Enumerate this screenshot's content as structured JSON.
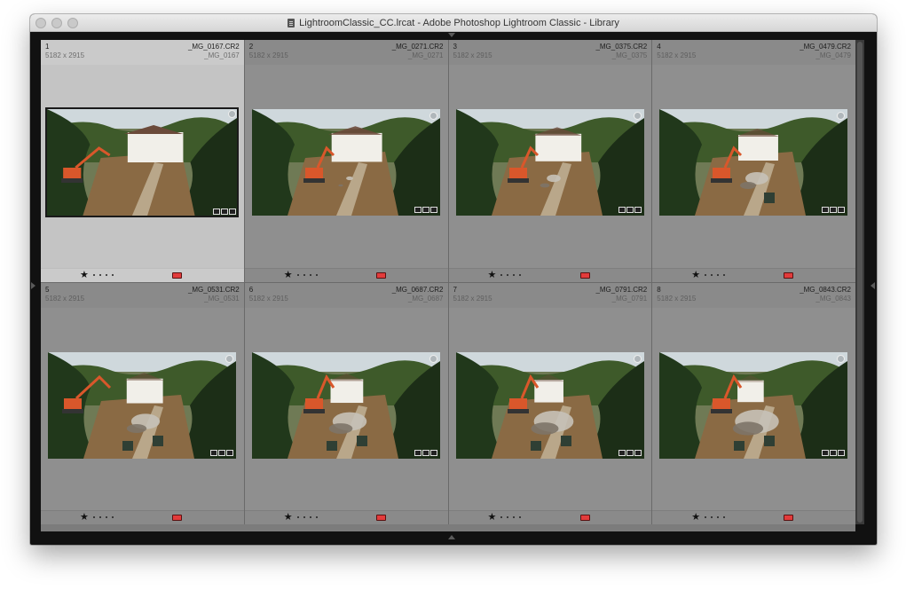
{
  "window": {
    "title": "LightroomClassic_CC.lrcat - Adobe Photoshop Lightroom Classic - Library"
  },
  "colors": {
    "label_red": "#e23b3b",
    "cell_bg": "#8f8f8f",
    "cell_selected_bg": "#c4c4c4"
  },
  "grid": {
    "cells": [
      {
        "index": "1",
        "filename": "_MG_0167.CR2",
        "dimensions": "5182 x 2915",
        "subname": "_MG_0167",
        "rating": "★",
        "selected": true
      },
      {
        "index": "2",
        "filename": "_MG_0271.CR2",
        "dimensions": "5182 x 2915",
        "subname": "_MG_0271",
        "rating": "★",
        "selected": false
      },
      {
        "index": "3",
        "filename": "_MG_0375.CR2",
        "dimensions": "5182 x 2915",
        "subname": "_MG_0375",
        "rating": "★",
        "selected": false
      },
      {
        "index": "4",
        "filename": "_MG_0479.CR2",
        "dimensions": "5182 x 2915",
        "subname": "_MG_0479",
        "rating": "★",
        "selected": false
      },
      {
        "index": "5",
        "filename": "_MG_0531.CR2",
        "dimensions": "5182 x 2915",
        "subname": "_MG_0531",
        "rating": "★",
        "selected": false
      },
      {
        "index": "6",
        "filename": "_MG_0687.CR2",
        "dimensions": "5182 x 2915",
        "subname": "_MG_0687",
        "rating": "★",
        "selected": false
      },
      {
        "index": "7",
        "filename": "_MG_0791.CR2",
        "dimensions": "5182 x 2915",
        "subname": "_MG_0791",
        "rating": "★",
        "selected": false
      },
      {
        "index": "8",
        "filename": "_MG_0843.CR2",
        "dimensions": "5182 x 2915",
        "subname": "_MG_0843",
        "rating": "★",
        "selected": false
      }
    ]
  }
}
